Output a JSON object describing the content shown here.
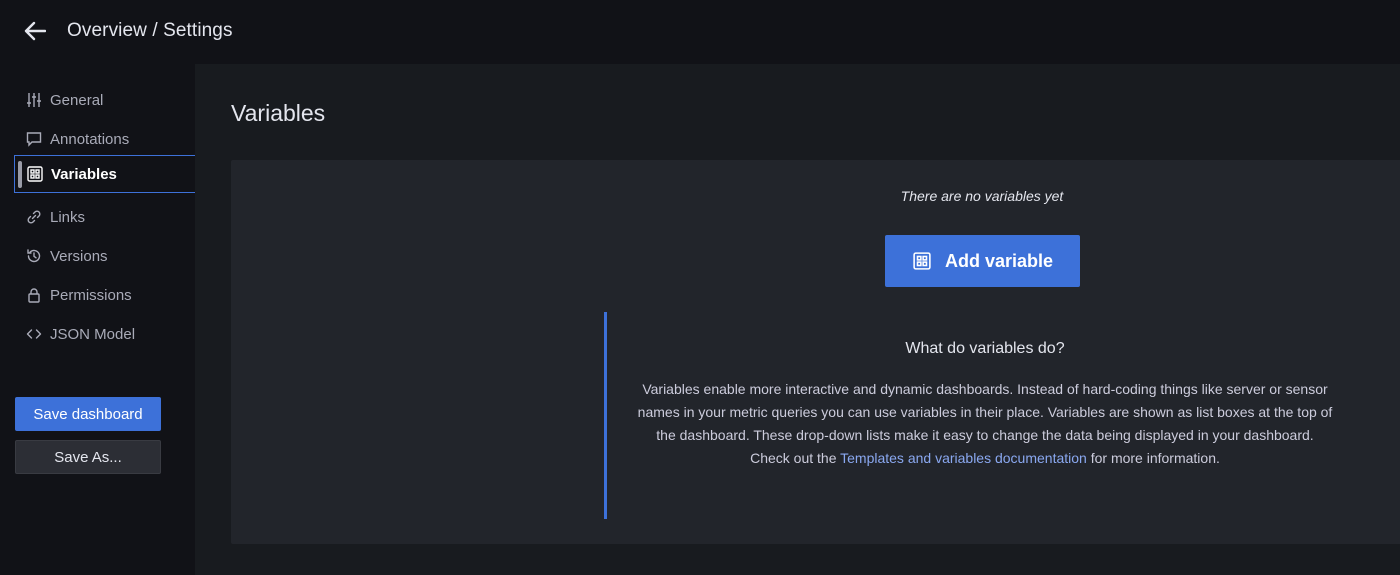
{
  "header": {
    "title": "Overview / Settings"
  },
  "sidebar": {
    "items": [
      {
        "label": "General",
        "icon": "sliders-icon"
      },
      {
        "label": "Annotations",
        "icon": "comment-icon"
      },
      {
        "label": "Variables",
        "icon": "variable-grid-icon",
        "active": true
      },
      {
        "label": "Links",
        "icon": "link-icon"
      },
      {
        "label": "Versions",
        "icon": "history-icon"
      },
      {
        "label": "Permissions",
        "icon": "lock-icon"
      },
      {
        "label": "JSON Model",
        "icon": "code-icon"
      }
    ],
    "save_label": "Save dashboard",
    "save_as_label": "Save As..."
  },
  "main": {
    "title": "Variables",
    "empty_text": "There are no variables yet",
    "add_button_label": "Add variable",
    "info": {
      "title": "What do variables do?",
      "body_before_link": "Variables enable more interactive and dynamic dashboards. Instead of hard-coding things like server or sensor names in your metric queries you can use variables in their place. Variables are shown as list boxes at the top of the dashboard. These drop-down lists make it easy to change the data being displayed in your dashboard. Check out the ",
      "link_text": "Templates and variables documentation",
      "body_after_link": " for more information."
    }
  },
  "colors": {
    "accent": "#3d71d9",
    "background": "#111217",
    "panel": "#181b1f",
    "card": "#22252b"
  }
}
